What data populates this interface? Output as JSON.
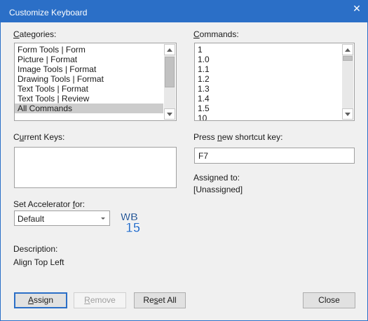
{
  "window": {
    "title": "Customize Keyboard",
    "close_glyph": "✕",
    "accent_color": "#2b6fc7"
  },
  "categories": {
    "label_key": "C",
    "label_rest": "ategories:",
    "items": [
      "Form Tools | Form",
      "Picture | Format",
      "Image Tools | Format",
      "Drawing Tools | Format",
      "Text Tools | Format",
      "Text Tools | Review",
      "All Commands"
    ],
    "selected_index": 6
  },
  "commands": {
    "label_key": "C",
    "label_rest": "ommands:",
    "items": [
      "1",
      "1.0",
      "1.1",
      "1.2",
      "1.3",
      "1.4",
      "1.5",
      "10"
    ]
  },
  "current_keys": {
    "label_pre": "C",
    "label_key": "u",
    "label_rest": "rrent Keys:"
  },
  "shortcut": {
    "label_pre": "Press ",
    "label_key": "n",
    "label_rest": "ew shortcut key:",
    "value": "F7"
  },
  "assigned": {
    "label": "Assigned to:",
    "value": "[Unassigned]"
  },
  "accelerator": {
    "label_pre": "Set Accelerator ",
    "label_key": "f",
    "label_rest": "or:",
    "selected": "Default"
  },
  "logo": {
    "text_top": "WB",
    "text_bottom": "15"
  },
  "description": {
    "label": "Description:",
    "value": "Align Top Left"
  },
  "buttons": {
    "assign_key": "A",
    "assign_rest": "ssign",
    "remove_key": "R",
    "remove_rest": "emove",
    "reset_pre": "Re",
    "reset_key": "s",
    "reset_rest": "et All",
    "close": "Close"
  }
}
